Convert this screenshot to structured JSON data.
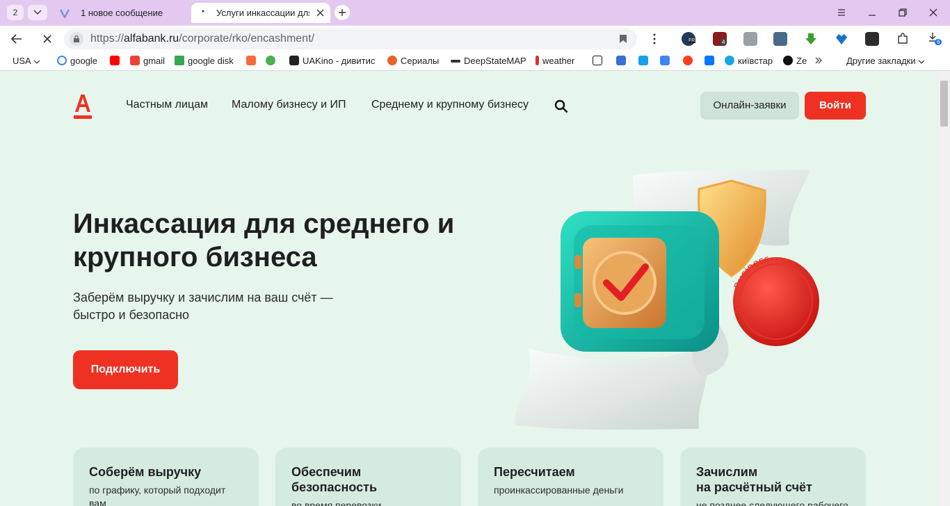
{
  "browser": {
    "tab_count": "2",
    "tabs": [
      {
        "title": "1 новое сообщение",
        "active": false
      },
      {
        "title": "Услуги инкассации для",
        "active": true
      }
    ],
    "url_host": "alfabank.ru",
    "url_path": "/corporate/rko/encashment/",
    "url_scheme": "https://",
    "ext_badges": {
      "flag": "FR",
      "ublock": "4",
      "downloads": "6"
    },
    "bookmarks": [
      {
        "label": "USA",
        "icon": "chevron-down-icon"
      },
      {
        "label": "google",
        "icon": "google-icon"
      },
      {
        "label": "",
        "icon": "youtube-icon"
      },
      {
        "label": "gmail",
        "icon": "gmail-icon"
      },
      {
        "label": "google disk",
        "icon": "google-drive-icon"
      },
      {
        "label": "",
        "icon": "f-icon"
      },
      {
        "label": "",
        "icon": "puzzle-star-icon"
      },
      {
        "label": "UAKino - дивитис",
        "icon": "uakino-icon"
      },
      {
        "label": "Сериалы",
        "icon": "fox-icon"
      },
      {
        "label": "DeepStateMAP",
        "icon": "deepstate-icon"
      },
      {
        "label": "weather",
        "icon": "thermometer-icon"
      },
      {
        "label": "",
        "icon": "bc-icon"
      },
      {
        "label": "",
        "icon": "k-icon"
      },
      {
        "label": "",
        "icon": "p-icon"
      },
      {
        "label": "",
        "icon": "translate-icon"
      },
      {
        "label": "",
        "icon": "yandex-icon"
      },
      {
        "label": "",
        "icon": "vk-icon"
      },
      {
        "label": "київстар",
        "icon": "kyivstar-icon"
      },
      {
        "label": "Ze",
        "icon": "z-icon"
      }
    ],
    "other_bookmarks": "Другие закладки"
  },
  "site": {
    "nav": [
      "Частным лицам",
      "Малому бизнесу и ИП",
      "Среднему и крупному бизнесу"
    ],
    "apps_button": "Онлайн-заявки",
    "login_button": "Войти",
    "hero": {
      "title": "Инкассация для среднего и крупного бизнеса",
      "subtitle": "Заберём выручку и зачислим на ваш счёт — быстро и безопасно",
      "cta": "Подключить",
      "coin_text": "Alfa Business"
    },
    "cards": [
      {
        "title": "Соберём выручку",
        "desc": "по графику, который подходит\nвам"
      },
      {
        "title": "Обеспечим\nбезопасность",
        "desc": "во время перевозки"
      },
      {
        "title": "Пересчитаем",
        "desc": "проинкассированные деньги"
      },
      {
        "title": "Зачислим\nна расчётный счёт",
        "desc": "не позднее следующего рабочего"
      }
    ]
  },
  "colors": {
    "page_bg": "#e6f6ec",
    "brand_red": "#ef3124",
    "card_bg": "#d6ebdf",
    "tabbar_bg": "#e3c9ef"
  }
}
